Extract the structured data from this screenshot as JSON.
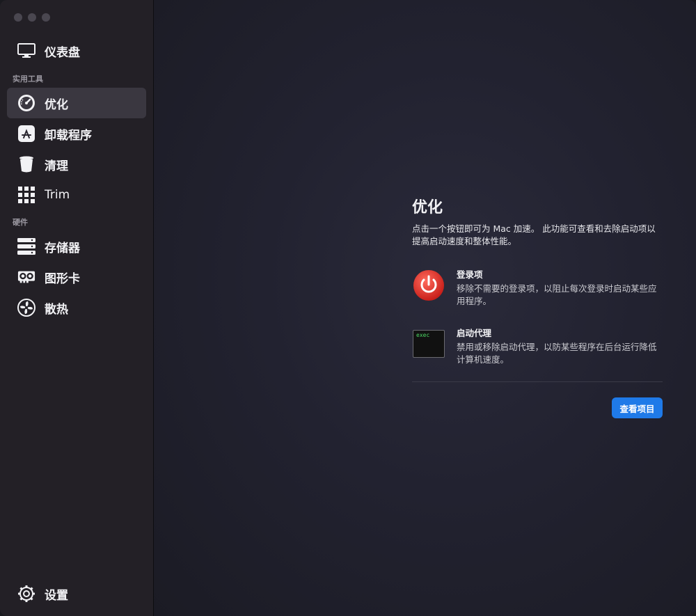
{
  "sidebar": {
    "dashboard": "仪表盘",
    "section_tools": "实用工具",
    "tools": [
      {
        "label": "优化",
        "icon": "speedometer-icon",
        "active": true
      },
      {
        "label": "卸载程序",
        "icon": "app-store-icon"
      },
      {
        "label": "清理",
        "icon": "trash-bin-icon"
      },
      {
        "label": "Trim",
        "icon": "grid-icon"
      }
    ],
    "section_hardware": "硬件",
    "hardware": [
      {
        "label": "存储器",
        "icon": "storage-drive-icon"
      },
      {
        "label": "图形卡",
        "icon": "graphics-card-icon"
      },
      {
        "label": "散热",
        "icon": "fan-icon"
      }
    ],
    "settings": "设置"
  },
  "main": {
    "title": "优化",
    "description": "点击一个按钮即可为 Mac 加速。 此功能可查看和去除启动项以提高启动速度和整体性能。",
    "features": [
      {
        "title": "登录项",
        "desc": "移除不需要的登录项，以阻止每次登录时启动某些应用程序。",
        "icon": "power-icon"
      },
      {
        "title": "启动代理",
        "desc": "禁用或移除启动代理，以防某些程序在后台运行降低计算机速度。",
        "icon": "terminal-exec-icon",
        "icon_text": "exec"
      }
    ],
    "button": "查看项目"
  },
  "colors": {
    "accent": "#1f7ae8",
    "power_red": "#e2372d"
  }
}
